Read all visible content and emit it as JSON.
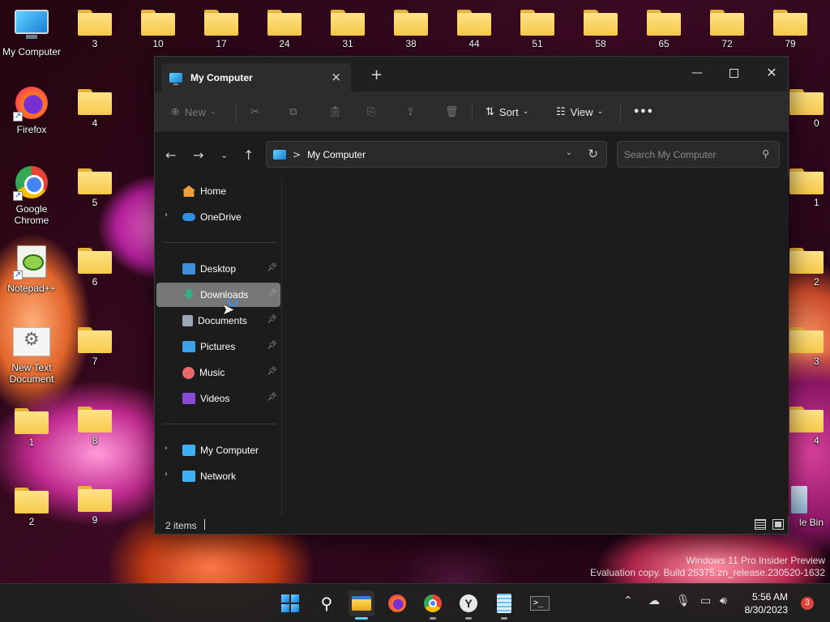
{
  "desktop": {
    "icons": [
      {
        "label": "My Computer",
        "kind": "monitor"
      },
      {
        "label": "Firefox",
        "kind": "firefox"
      },
      {
        "label": "Google Chrome",
        "kind": "chrome"
      },
      {
        "label": "Notepad++",
        "kind": "notepadpp"
      },
      {
        "label": "New Text Document",
        "kind": "textdoc"
      },
      {
        "label": "1",
        "kind": "folder"
      },
      {
        "label": "2",
        "kind": "folder"
      },
      {
        "label": "3",
        "kind": "folder"
      },
      {
        "label": "4",
        "kind": "folder"
      },
      {
        "label": "5",
        "kind": "folder"
      },
      {
        "label": "6",
        "kind": "folder"
      },
      {
        "label": "7",
        "kind": "folder"
      },
      {
        "label": "8",
        "kind": "folder"
      },
      {
        "label": "9",
        "kind": "folder"
      },
      {
        "label": "10",
        "kind": "folder"
      },
      {
        "label": "17",
        "kind": "folder"
      },
      {
        "label": "24",
        "kind": "folder"
      },
      {
        "label": "31",
        "kind": "folder"
      },
      {
        "label": "38",
        "kind": "folder"
      },
      {
        "label": "44",
        "kind": "folder"
      },
      {
        "label": "51",
        "kind": "folder"
      },
      {
        "label": "58",
        "kind": "folder"
      },
      {
        "label": "65",
        "kind": "folder"
      },
      {
        "label": "72",
        "kind": "folder"
      },
      {
        "label": "79",
        "kind": "folder"
      },
      {
        "label": "0",
        "kind": "folder"
      },
      {
        "label": "1",
        "kind": "folder"
      },
      {
        "label": "2",
        "kind": "folder"
      },
      {
        "label": "3",
        "kind": "folder"
      },
      {
        "label": "4",
        "kind": "folder"
      },
      {
        "label": "le Bin",
        "kind": "recycle-bin"
      }
    ],
    "watermark_line1": "Windows 11 Pro Insider Preview",
    "watermark_line2": "Evaluation copy. Build 25375.zn_release.230520-1632"
  },
  "explorer": {
    "tab_title": "My Computer",
    "tab_close_icon": "×",
    "new_tab_icon": "+",
    "controls": {
      "minimize": "—",
      "close": "✕"
    },
    "toolbar": {
      "new_label": "New",
      "sort_label": "Sort",
      "view_label": "View",
      "more_icon": "•••"
    },
    "nav": {
      "back_icon": "←",
      "forward_icon": "→",
      "recent_icon": "⌄",
      "up_icon": "↑"
    },
    "address": {
      "separator": ">",
      "path": "My Computer",
      "dropdown_icon": "⌄",
      "refresh_icon": "↻"
    },
    "search": {
      "placeholder": "Search My Computer",
      "value": ""
    },
    "sidebar": {
      "items": [
        {
          "label": "Home",
          "icon": "home-icon",
          "color": "#f0a040"
        },
        {
          "label": "OneDrive",
          "icon": "cloud-icon",
          "color": "#2f8fe0"
        },
        {
          "label": "Desktop",
          "icon": "desktop-icon",
          "color": "#3f8fd8"
        },
        {
          "label": "Downloads",
          "icon": "download-icon",
          "color": "#2fb080"
        },
        {
          "label": "Documents",
          "icon": "documents-icon",
          "color": "#9aa5b5"
        },
        {
          "label": "Pictures",
          "icon": "pictures-icon",
          "color": "#3aa0e8"
        },
        {
          "label": "Music",
          "icon": "music-icon",
          "color": "#e86a6a"
        },
        {
          "label": "Videos",
          "icon": "videos-icon",
          "color": "#8a4ad8"
        },
        {
          "label": "My Computer",
          "icon": "computer-icon",
          "color": "#3fb0f0"
        },
        {
          "label": "Network",
          "icon": "network-icon",
          "color": "#3fb0f0"
        }
      ],
      "selected": "Downloads"
    },
    "status": {
      "item_count": "2 items"
    }
  },
  "taskbar": {
    "apps": [
      "start",
      "search",
      "file-explorer",
      "firefox",
      "chrome",
      "yandex",
      "notepad",
      "terminal"
    ],
    "active_app": "file-explorer",
    "time": "5:56 AM",
    "date": "8/30/2023",
    "notification_count": "3"
  }
}
